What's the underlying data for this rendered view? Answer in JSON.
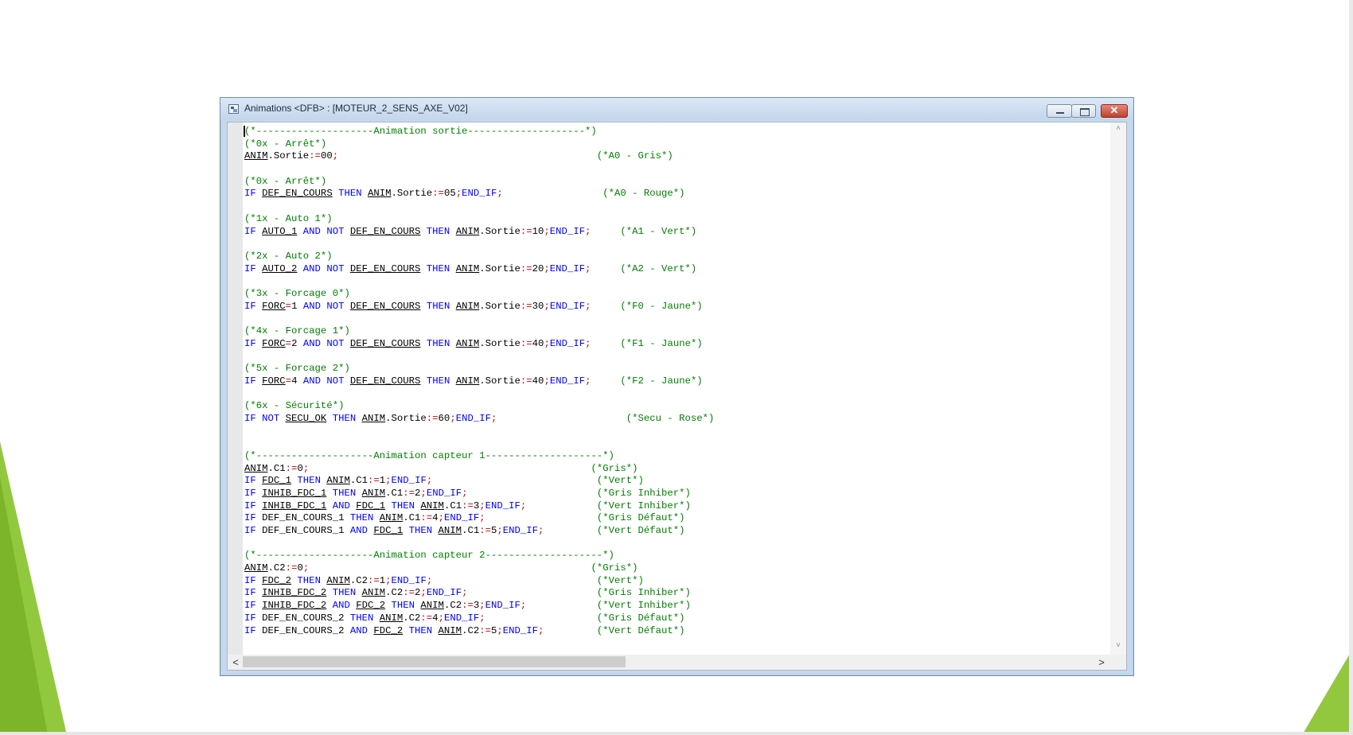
{
  "window": {
    "title": "Animations <DFB> : [MOTEUR_2_SENS_AXE_V02]",
    "minimize": "—",
    "maximize": "□",
    "close": "✕"
  },
  "icons": {
    "app": "app-window-icon",
    "minimize": "minimize-icon",
    "maximize": "maximize-icon",
    "close": "close-icon",
    "scroll_up": "chevron-up-icon",
    "scroll_down": "chevron-down-icon",
    "scroll_left": "chevron-left-icon",
    "scroll_right": "chevron-right-icon",
    "resize_grip": "resize-grip-icon"
  },
  "colors": {
    "keyword": "#0000ff",
    "comment": "#008000",
    "operator": "#cc0000",
    "variable": "#000000",
    "titlebar": "#c8daee",
    "close_button": "#c1412c"
  },
  "scroll": {
    "up": "˄",
    "down": "˅",
    "left": "<",
    "right": ">"
  },
  "code_lines": [
    [
      [
        "cm",
        "(*--------------------Animation sortie--------------------*)"
      ]
    ],
    [
      [
        "cm",
        "(*0x - Arrêt*)"
      ]
    ],
    [
      [
        "vr",
        "ANIM"
      ],
      [
        "pl",
        ".Sortie"
      ],
      [
        "op",
        ":="
      ],
      [
        "nm",
        "00"
      ],
      [
        "op",
        ";"
      ],
      [
        "pl",
        "                                            "
      ],
      [
        "cm",
        "(*A0 - Gris*)"
      ]
    ],
    [],
    [
      [
        "cm",
        "(*0x - Arrêt*)"
      ]
    ],
    [
      [
        "kw",
        "IF "
      ],
      [
        "vr",
        "DEF_EN_COURS"
      ],
      [
        "kw",
        " THEN "
      ],
      [
        "vr",
        "ANIM"
      ],
      [
        "pl",
        ".Sortie"
      ],
      [
        "op",
        ":="
      ],
      [
        "nm",
        "05"
      ],
      [
        "op",
        ";"
      ],
      [
        "kw",
        "END_IF"
      ],
      [
        "op",
        ";"
      ],
      [
        "pl",
        "                 "
      ],
      [
        "cm",
        "(*A0 - Rouge*)"
      ]
    ],
    [],
    [
      [
        "cm",
        "(*1x - Auto 1*)"
      ]
    ],
    [
      [
        "kw",
        "IF "
      ],
      [
        "vr",
        "AUTO_1"
      ],
      [
        "kw",
        " AND NOT "
      ],
      [
        "vr",
        "DEF_EN_COURS"
      ],
      [
        "kw",
        " THEN "
      ],
      [
        "vr",
        "ANIM"
      ],
      [
        "pl",
        ".Sortie"
      ],
      [
        "op",
        ":="
      ],
      [
        "nm",
        "10"
      ],
      [
        "op",
        ";"
      ],
      [
        "kw",
        "END_IF"
      ],
      [
        "op",
        ";"
      ],
      [
        "pl",
        "     "
      ],
      [
        "cm",
        "(*A1 - Vert*)"
      ]
    ],
    [],
    [
      [
        "cm",
        "(*2x - Auto 2*)"
      ]
    ],
    [
      [
        "kw",
        "IF "
      ],
      [
        "vr",
        "AUTO_2"
      ],
      [
        "kw",
        " AND NOT "
      ],
      [
        "vr",
        "DEF_EN_COURS"
      ],
      [
        "kw",
        " THEN "
      ],
      [
        "vr",
        "ANIM"
      ],
      [
        "pl",
        ".Sortie"
      ],
      [
        "op",
        ":="
      ],
      [
        "nm",
        "20"
      ],
      [
        "op",
        ";"
      ],
      [
        "kw",
        "END_IF"
      ],
      [
        "op",
        ";"
      ],
      [
        "pl",
        "     "
      ],
      [
        "cm",
        "(*A2 - Vert*)"
      ]
    ],
    [],
    [
      [
        "cm",
        "(*3x - Forcage 0*)"
      ]
    ],
    [
      [
        "kw",
        "IF "
      ],
      [
        "vr",
        "FORC"
      ],
      [
        "op",
        "="
      ],
      [
        "nm",
        "1"
      ],
      [
        "kw",
        " AND NOT "
      ],
      [
        "vr",
        "DEF_EN_COURS"
      ],
      [
        "kw",
        " THEN "
      ],
      [
        "vr",
        "ANIM"
      ],
      [
        "pl",
        ".Sortie"
      ],
      [
        "op",
        ":="
      ],
      [
        "nm",
        "30"
      ],
      [
        "op",
        ";"
      ],
      [
        "kw",
        "END_IF"
      ],
      [
        "op",
        ";"
      ],
      [
        "pl",
        "     "
      ],
      [
        "cm",
        "(*F0 - Jaune*)"
      ]
    ],
    [],
    [
      [
        "cm",
        "(*4x - Forcage 1*)"
      ]
    ],
    [
      [
        "kw",
        "IF "
      ],
      [
        "vr",
        "FORC"
      ],
      [
        "op",
        "="
      ],
      [
        "nm",
        "2"
      ],
      [
        "kw",
        " AND NOT "
      ],
      [
        "vr",
        "DEF_EN_COURS"
      ],
      [
        "kw",
        " THEN "
      ],
      [
        "vr",
        "ANIM"
      ],
      [
        "pl",
        ".Sortie"
      ],
      [
        "op",
        ":="
      ],
      [
        "nm",
        "40"
      ],
      [
        "op",
        ";"
      ],
      [
        "kw",
        "END_IF"
      ],
      [
        "op",
        ";"
      ],
      [
        "pl",
        "     "
      ],
      [
        "cm",
        "(*F1 - Jaune*)"
      ]
    ],
    [],
    [
      [
        "cm",
        "(*5x - Forcage 2*)"
      ]
    ],
    [
      [
        "kw",
        "IF "
      ],
      [
        "vr",
        "FORC"
      ],
      [
        "op",
        "="
      ],
      [
        "nm",
        "4"
      ],
      [
        "kw",
        " AND NOT "
      ],
      [
        "vr",
        "DEF_EN_COURS"
      ],
      [
        "kw",
        " THEN "
      ],
      [
        "vr",
        "ANIM"
      ],
      [
        "pl",
        ".Sortie"
      ],
      [
        "op",
        ":="
      ],
      [
        "nm",
        "40"
      ],
      [
        "op",
        ";"
      ],
      [
        "kw",
        "END_IF"
      ],
      [
        "op",
        ";"
      ],
      [
        "pl",
        "     "
      ],
      [
        "cm",
        "(*F2 - Jaune*)"
      ]
    ],
    [],
    [
      [
        "cm",
        "(*6x - Sécurité*)"
      ]
    ],
    [
      [
        "kw",
        "IF NOT "
      ],
      [
        "vr",
        "SECU_OK"
      ],
      [
        "kw",
        " THEN "
      ],
      [
        "vr",
        "ANIM"
      ],
      [
        "pl",
        ".Sortie"
      ],
      [
        "op",
        ":="
      ],
      [
        "nm",
        "60"
      ],
      [
        "op",
        ";"
      ],
      [
        "kw",
        "END_IF"
      ],
      [
        "op",
        ";"
      ],
      [
        "pl",
        "                      "
      ],
      [
        "cm",
        "(*Secu - Rose*)"
      ]
    ],
    [],
    [],
    [
      [
        "cm",
        "(*--------------------Animation capteur 1--------------------*)"
      ]
    ],
    [
      [
        "vr",
        "ANIM"
      ],
      [
        "pl",
        ".C1"
      ],
      [
        "op",
        ":="
      ],
      [
        "nm",
        "0"
      ],
      [
        "op",
        ";"
      ],
      [
        "pl",
        "                                                "
      ],
      [
        "cm",
        "(*Gris*)"
      ]
    ],
    [
      [
        "kw",
        "IF "
      ],
      [
        "vr",
        "FDC_1"
      ],
      [
        "kw",
        " THEN "
      ],
      [
        "vr",
        "ANIM"
      ],
      [
        "pl",
        ".C1"
      ],
      [
        "op",
        ":="
      ],
      [
        "nm",
        "1"
      ],
      [
        "op",
        ";"
      ],
      [
        "kw",
        "END_IF"
      ],
      [
        "op",
        ";"
      ],
      [
        "pl",
        "                            "
      ],
      [
        "cm",
        "(*Vert*)"
      ]
    ],
    [
      [
        "kw",
        "IF "
      ],
      [
        "vr",
        "INHIB_FDC_1"
      ],
      [
        "kw",
        " THEN "
      ],
      [
        "vr",
        "ANIM"
      ],
      [
        "pl",
        ".C1"
      ],
      [
        "op",
        ":="
      ],
      [
        "nm",
        "2"
      ],
      [
        "op",
        ";"
      ],
      [
        "kw",
        "END_IF"
      ],
      [
        "op",
        ";"
      ],
      [
        "pl",
        "                      "
      ],
      [
        "cm",
        "(*Gris Inhiber*)"
      ]
    ],
    [
      [
        "kw",
        "IF "
      ],
      [
        "vr",
        "INHIB_FDC_1"
      ],
      [
        "kw",
        " AND "
      ],
      [
        "vr",
        "FDC_1"
      ],
      [
        "kw",
        " THEN "
      ],
      [
        "vr",
        "ANIM"
      ],
      [
        "pl",
        ".C1"
      ],
      [
        "op",
        ":="
      ],
      [
        "nm",
        "3"
      ],
      [
        "op",
        ";"
      ],
      [
        "kw",
        "END_IF"
      ],
      [
        "op",
        ";"
      ],
      [
        "pl",
        "            "
      ],
      [
        "cm",
        "(*Vert Inhiber*)"
      ]
    ],
    [
      [
        "kw",
        "IF "
      ],
      [
        "pl",
        "DEF_EN_COURS_1"
      ],
      [
        "kw",
        " THEN "
      ],
      [
        "vr",
        "ANIM"
      ],
      [
        "pl",
        ".C1"
      ],
      [
        "op",
        ":="
      ],
      [
        "nm",
        "4"
      ],
      [
        "op",
        ";"
      ],
      [
        "kw",
        "END_IF"
      ],
      [
        "op",
        ";"
      ],
      [
        "pl",
        "                   "
      ],
      [
        "cm",
        "(*Gris Défaut*)"
      ]
    ],
    [
      [
        "kw",
        "IF "
      ],
      [
        "pl",
        "DEF_EN_COURS_1"
      ],
      [
        "kw",
        " AND "
      ],
      [
        "vr",
        "FDC_1"
      ],
      [
        "kw",
        " THEN "
      ],
      [
        "vr",
        "ANIM"
      ],
      [
        "pl",
        ".C1"
      ],
      [
        "op",
        ":="
      ],
      [
        "nm",
        "5"
      ],
      [
        "op",
        ";"
      ],
      [
        "kw",
        "END_IF"
      ],
      [
        "op",
        ";"
      ],
      [
        "pl",
        "         "
      ],
      [
        "cm",
        "(*Vert Défaut*)"
      ]
    ],
    [],
    [
      [
        "cm",
        "(*--------------------Animation capteur 2--------------------*)"
      ]
    ],
    [
      [
        "vr",
        "ANIM"
      ],
      [
        "pl",
        ".C2"
      ],
      [
        "op",
        ":="
      ],
      [
        "nm",
        "0"
      ],
      [
        "op",
        ";"
      ],
      [
        "pl",
        "                                                "
      ],
      [
        "cm",
        "(*Gris*)"
      ]
    ],
    [
      [
        "kw",
        "IF "
      ],
      [
        "vr",
        "FDC_2"
      ],
      [
        "kw",
        " THEN "
      ],
      [
        "vr",
        "ANIM"
      ],
      [
        "pl",
        ".C2"
      ],
      [
        "op",
        ":="
      ],
      [
        "nm",
        "1"
      ],
      [
        "op",
        ";"
      ],
      [
        "kw",
        "END_IF"
      ],
      [
        "op",
        ";"
      ],
      [
        "pl",
        "                            "
      ],
      [
        "cm",
        "(*Vert*)"
      ]
    ],
    [
      [
        "kw",
        "IF "
      ],
      [
        "vr",
        "INHIB_FDC_2"
      ],
      [
        "kw",
        " THEN "
      ],
      [
        "vr",
        "ANIM"
      ],
      [
        "pl",
        ".C2"
      ],
      [
        "op",
        ":="
      ],
      [
        "nm",
        "2"
      ],
      [
        "op",
        ";"
      ],
      [
        "kw",
        "END_IF"
      ],
      [
        "op",
        ";"
      ],
      [
        "pl",
        "                      "
      ],
      [
        "cm",
        "(*Gris Inhiber*)"
      ]
    ],
    [
      [
        "kw",
        "IF "
      ],
      [
        "vr",
        "INHIB_FDC_2"
      ],
      [
        "kw",
        " AND "
      ],
      [
        "vr",
        "FDC_2"
      ],
      [
        "kw",
        " THEN "
      ],
      [
        "vr",
        "ANIM"
      ],
      [
        "pl",
        ".C2"
      ],
      [
        "op",
        ":="
      ],
      [
        "nm",
        "3"
      ],
      [
        "op",
        ";"
      ],
      [
        "kw",
        "END_IF"
      ],
      [
        "op",
        ";"
      ],
      [
        "pl",
        "            "
      ],
      [
        "cm",
        "(*Vert Inhiber*)"
      ]
    ],
    [
      [
        "kw",
        "IF "
      ],
      [
        "pl",
        "DEF_EN_COURS_2"
      ],
      [
        "kw",
        " THEN "
      ],
      [
        "vr",
        "ANIM"
      ],
      [
        "pl",
        ".C2"
      ],
      [
        "op",
        ":="
      ],
      [
        "nm",
        "4"
      ],
      [
        "op",
        ";"
      ],
      [
        "kw",
        "END_IF"
      ],
      [
        "op",
        ";"
      ],
      [
        "pl",
        "                   "
      ],
      [
        "cm",
        "(*Gris Défaut*)"
      ]
    ],
    [
      [
        "kw",
        "IF "
      ],
      [
        "pl",
        "DEF_EN_COURS_2"
      ],
      [
        "kw",
        " AND "
      ],
      [
        "vr",
        "FDC_2"
      ],
      [
        "kw",
        " THEN "
      ],
      [
        "vr",
        "ANIM"
      ],
      [
        "pl",
        ".C2"
      ],
      [
        "op",
        ":="
      ],
      [
        "nm",
        "5"
      ],
      [
        "op",
        ";"
      ],
      [
        "kw",
        "END_IF"
      ],
      [
        "op",
        ";"
      ],
      [
        "pl",
        "         "
      ],
      [
        "cm",
        "(*Vert Défaut*)"
      ]
    ]
  ]
}
